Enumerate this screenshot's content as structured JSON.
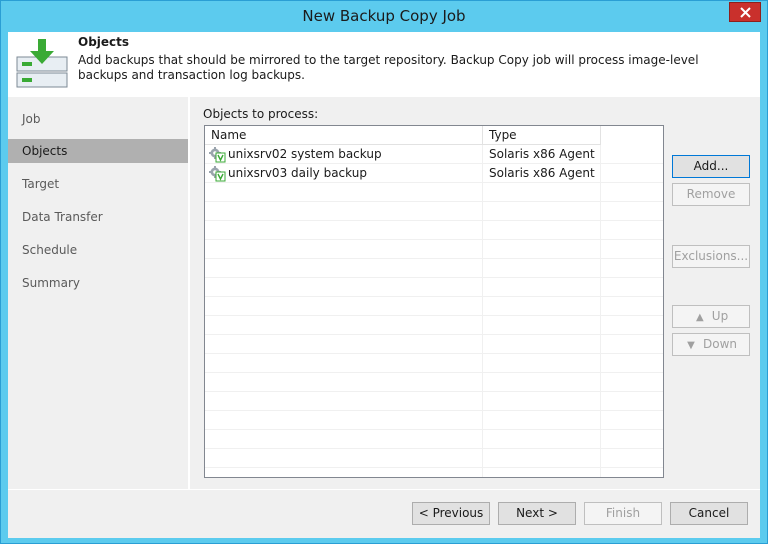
{
  "window": {
    "title": "New Backup Copy Job"
  },
  "header": {
    "title": "Objects",
    "description": "Add backups that should be mirrored to the target repository. Backup Copy job will process image-level backups and transaction log backups."
  },
  "sidebar": {
    "items": [
      {
        "label": "Job"
      },
      {
        "label": "Objects",
        "active": true
      },
      {
        "label": "Target"
      },
      {
        "label": "Data Transfer"
      },
      {
        "label": "Schedule"
      },
      {
        "label": "Summary"
      }
    ]
  },
  "objects": {
    "label": "Objects to process:",
    "columns": [
      "Name",
      "Type"
    ],
    "rows": [
      {
        "name": "unixsrv02 system backup",
        "type": "Solaris x86 Agent ..."
      },
      {
        "name": "unixsrv03 daily backup",
        "type": "Solaris x86 Agent ..."
      }
    ]
  },
  "actions": {
    "add": "Add...",
    "remove": "Remove",
    "exclusions": "Exclusions...",
    "up": "Up",
    "down": "Down"
  },
  "footer": {
    "previous": "< Previous",
    "next": "Next >",
    "finish": "Finish",
    "cancel": "Cancel"
  },
  "icons": {
    "close": "close-icon",
    "header": "backup-copy-job-icon",
    "row": "agent-backup-icon",
    "up": "up-arrow-icon",
    "down": "down-arrow-icon"
  },
  "colors": {
    "titlebar": "#5ccbee",
    "close": "#c9302c",
    "active_nav": "#b0b0b0",
    "icon_green": "#3aaa35"
  }
}
